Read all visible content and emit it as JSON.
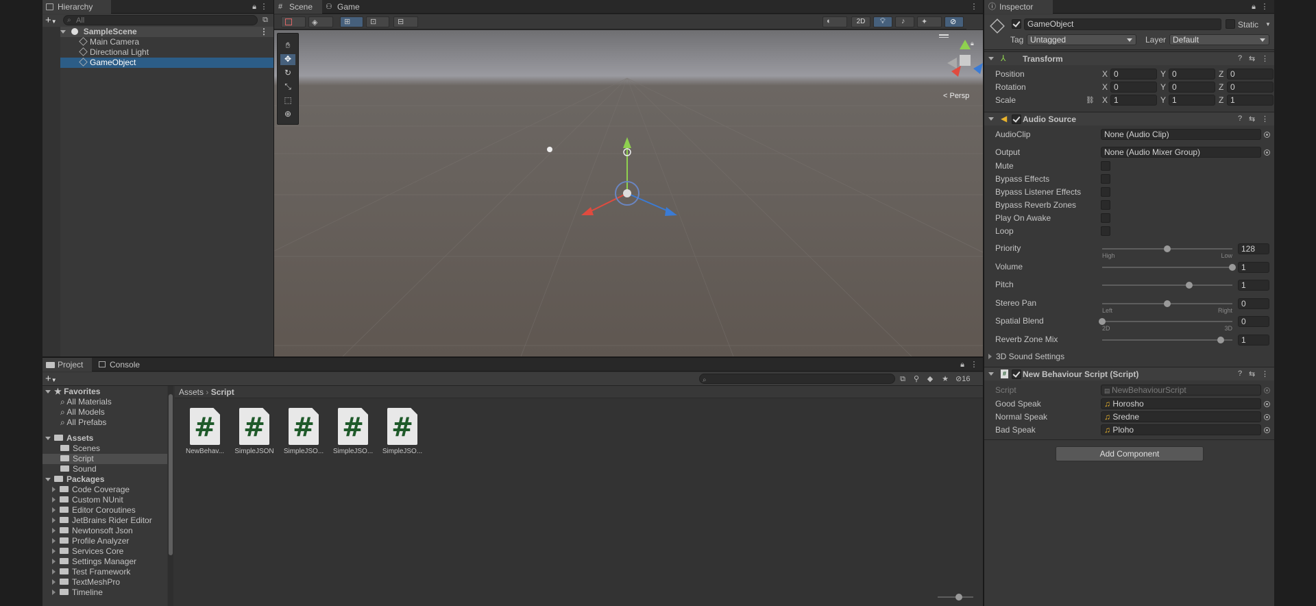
{
  "hierarchy": {
    "tab": "Hierarchy",
    "search_placeholder": "All",
    "scene": "SampleScene",
    "items": [
      "Main Camera",
      "Directional Light",
      "GameObject"
    ]
  },
  "scene_view": {
    "tabs": [
      "Scene",
      "Game"
    ],
    "persp_label": "< Persp",
    "mode_2d": "2D"
  },
  "project": {
    "tabs": [
      "Project",
      "Console"
    ],
    "favorites": {
      "label": "Favorites",
      "items": [
        "All Materials",
        "All Models",
        "All Prefabs"
      ]
    },
    "assets": {
      "label": "Assets",
      "items": [
        "Scenes",
        "Script",
        "Sound"
      ]
    },
    "packages": {
      "label": "Packages",
      "items": [
        "Code Coverage",
        "Custom NUnit",
        "Editor Coroutines",
        "JetBrains Rider Editor",
        "Newtonsoft Json",
        "Profile Analyzer",
        "Services Core",
        "Settings Manager",
        "Test Framework",
        "TextMeshPro",
        "Timeline"
      ]
    },
    "breadcrumb": [
      "Assets",
      "Script"
    ],
    "hidden_count": "16",
    "files": [
      "NewBehav...",
      "SimpleJSON",
      "SimpleJSO...",
      "SimpleJSO...",
      "SimpleJSO..."
    ]
  },
  "inspector": {
    "tab": "Inspector",
    "object_name": "GameObject",
    "static_label": "Static",
    "tag_label": "Tag",
    "tag_value": "Untagged",
    "layer_label": "Layer",
    "layer_value": "Default",
    "transform": {
      "title": "Transform",
      "rows": [
        {
          "label": "Position",
          "x": "0",
          "y": "0",
          "z": "0"
        },
        {
          "label": "Rotation",
          "x": "0",
          "y": "0",
          "z": "0"
        },
        {
          "label": "Scale",
          "x": "1",
          "y": "1",
          "z": "1"
        }
      ]
    },
    "audio_source": {
      "title": "Audio Source",
      "audioclip_label": "AudioClip",
      "audioclip_value": "None (Audio Clip)",
      "output_label": "Output",
      "output_value": "None (Audio Mixer Group)",
      "toggles": [
        "Mute",
        "Bypass Effects",
        "Bypass Listener Effects",
        "Bypass Reverb Zones",
        "Play On Awake",
        "Loop"
      ],
      "sliders": [
        {
          "label": "Priority",
          "value": "128",
          "level": 0.5,
          "min_label": "High",
          "max_label": "Low"
        },
        {
          "label": "Volume",
          "value": "1",
          "level": 1.0,
          "min_label": "",
          "max_label": ""
        },
        {
          "label": "Pitch",
          "value": "1",
          "level": 0.67,
          "min_label": "",
          "max_label": ""
        },
        {
          "label": "Stereo Pan",
          "value": "0",
          "level": 0.5,
          "min_label": "Left",
          "max_label": "Right"
        },
        {
          "label": "Spatial Blend",
          "value": "0",
          "level": 0.0,
          "min_label": "2D",
          "max_label": "3D"
        },
        {
          "label": "Reverb Zone Mix",
          "value": "1",
          "level": 0.91,
          "min_label": "",
          "max_label": ""
        }
      ],
      "sound_settings": "3D Sound Settings"
    },
    "script": {
      "title": "New Behaviour Script (Script)",
      "script_label": "Script",
      "script_value": "NewBehaviourScript",
      "fields": [
        {
          "label": "Good Speak",
          "value": "Horosho"
        },
        {
          "label": "Normal Speak",
          "value": "Sredne"
        },
        {
          "label": "Bad Speak",
          "value": "Ploho"
        }
      ]
    },
    "add_component": "Add Component"
  },
  "colors": {
    "selection": "#2c5d87",
    "accent_blue": "#46607c",
    "panel": "#383838"
  }
}
